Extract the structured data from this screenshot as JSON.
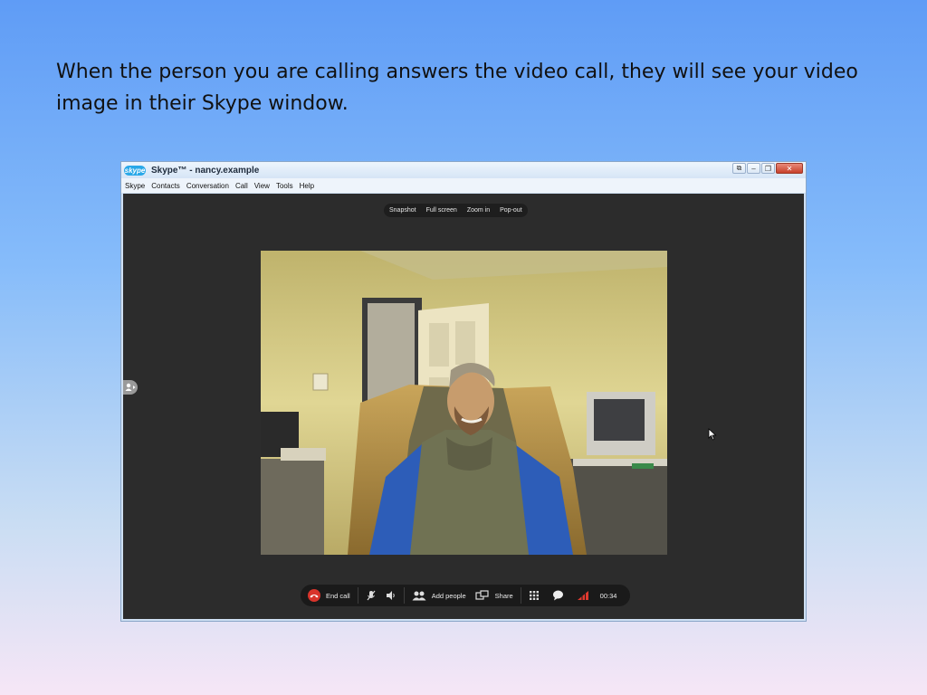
{
  "slide": {
    "text": "When the person you are calling answers the video call, they will see your video image in their Skype window."
  },
  "window": {
    "logo_text": "skype",
    "title": "Skype™ - nancy.example",
    "menu": [
      "Skype",
      "Contacts",
      "Conversation",
      "Call",
      "View",
      "Tools",
      "Help"
    ]
  },
  "video_toolbar": [
    "Snapshot",
    "Full screen",
    "Zoom in",
    "Pop-out"
  ],
  "call_bar": {
    "end_call": "End call",
    "add_people": "Add people",
    "share": "Share",
    "timer": "00:34"
  },
  "colors": {
    "end_call_icon": "#d8342b",
    "signal_icon": "#e0392f",
    "stage_bg": "#2c2c2c"
  }
}
